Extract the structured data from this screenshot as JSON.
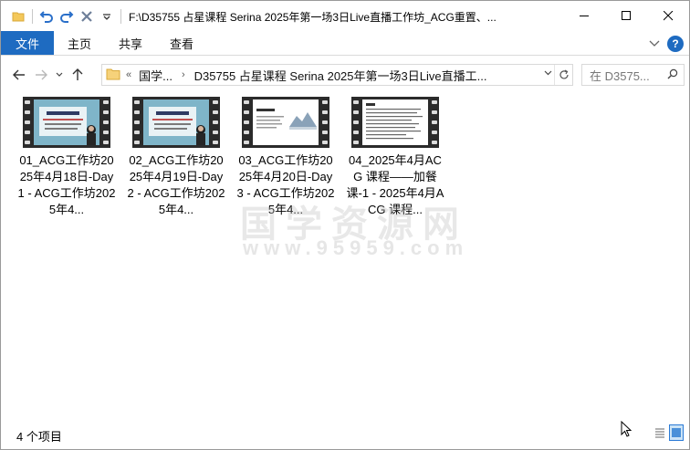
{
  "window": {
    "title": "F:\\D35755 占星课程 Serina 2025年第一场3日Live直播工作坊_ACG重置、..."
  },
  "ribbon": {
    "tabs": [
      "文件",
      "主页",
      "共享",
      "查看"
    ]
  },
  "address": {
    "crumbs": [
      "国学...",
      "D35755 占星课程 Serina 2025年第一场3日Live直播工..."
    ],
    "search_placeholder": "在 D3575..."
  },
  "files": [
    {
      "name": "01_ACG工作坊2025年4月18日-Day 1 - ACG工作坊2025年4...",
      "thumb": {
        "type": "slide",
        "heading": "2025年4月18-20日",
        "bg": "#6fa9bf"
      }
    },
    {
      "name": "02_ACG工作坊2025年4月19日-Day 2 - ACG工作坊2025年4...",
      "thumb": {
        "type": "slide",
        "heading": "2025年4月18-20日",
        "bg": "#6fa9bf"
      }
    },
    {
      "name": "03_ACG工作坊2025年4月20日-Day 3 - ACG工作坊2025年4...",
      "thumb": {
        "type": "doc",
        "heading": "学前目标",
        "bg": "#ffffff"
      }
    },
    {
      "name": "04_2025年4月ACG 课程——加餐课-1 - 2025年4月ACG 课程...",
      "thumb": {
        "type": "text",
        "heading": "Q&A",
        "bg": "#ffffff"
      }
    }
  ],
  "watermark": {
    "line1": "国学资源网",
    "line2": "www.95959.com"
  },
  "status": {
    "item_count": "4 个项目"
  },
  "colors": {
    "accent": "#1e6bc1"
  }
}
